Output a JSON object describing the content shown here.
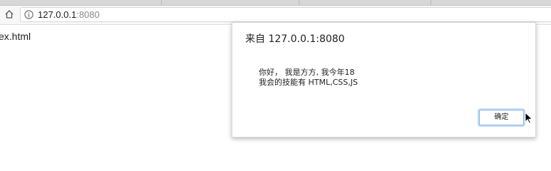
{
  "browser": {
    "url_host": "127.0.0.1",
    "url_port": ":8080",
    "home_icon": "home-icon",
    "info_icon": "info-icon"
  },
  "page": {
    "partial_filename": "ex.html"
  },
  "alert_dialog": {
    "title": "来自 127.0.0.1:8080",
    "message_line1": "你好，  我是方方, 我今年18",
    "message_line2": "我会的技能有 HTML,CSS,JS",
    "ok_label": "确定"
  },
  "colors": {
    "focus_ring": "#7fb2e8",
    "url_port": "#8a8a8a"
  }
}
